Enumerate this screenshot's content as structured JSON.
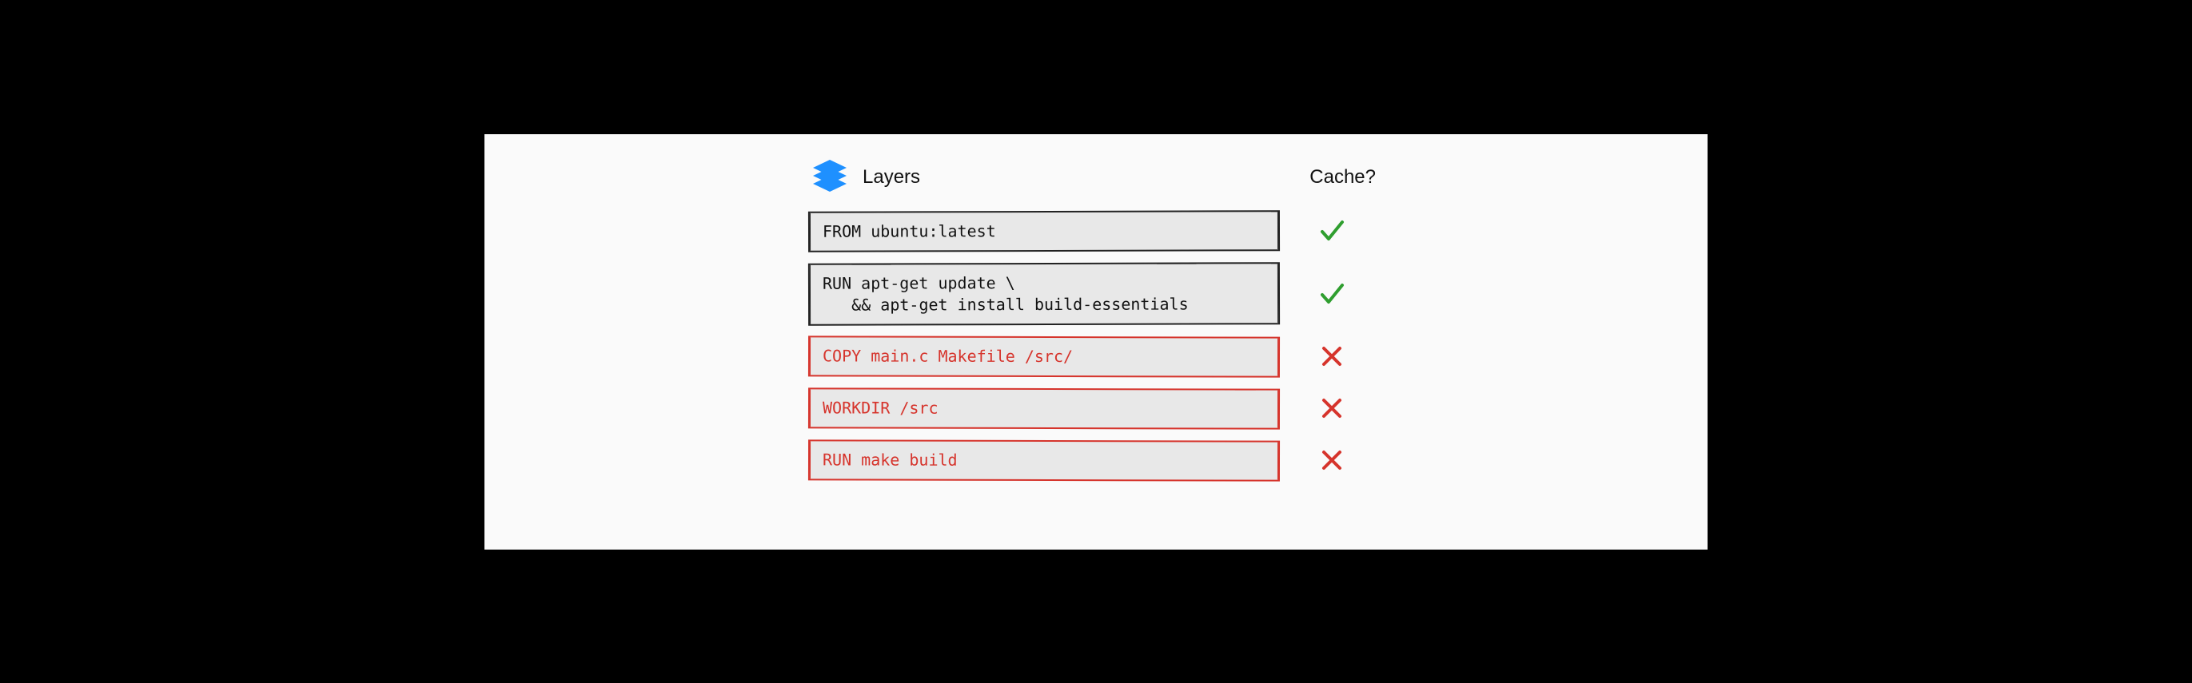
{
  "header": {
    "layers_label": "Layers",
    "cache_label": "Cache?"
  },
  "colors": {
    "accent_blue": "#1e90ff",
    "green": "#2f9e2f",
    "red": "#d6342c",
    "box_bg": "#e8e8e8",
    "panel_bg": "#fafafa"
  },
  "layers": [
    {
      "text": "FROM ubuntu:latest",
      "style": "black",
      "cached": true
    },
    {
      "text": "RUN apt-get update \\\n   && apt-get install build-essentials",
      "style": "black",
      "cached": true
    },
    {
      "text": "COPY main.c Makefile /src/",
      "style": "red",
      "cached": false
    },
    {
      "text": "WORKDIR /src",
      "style": "red",
      "cached": false
    },
    {
      "text": "RUN make build",
      "style": "red",
      "cached": false
    }
  ]
}
